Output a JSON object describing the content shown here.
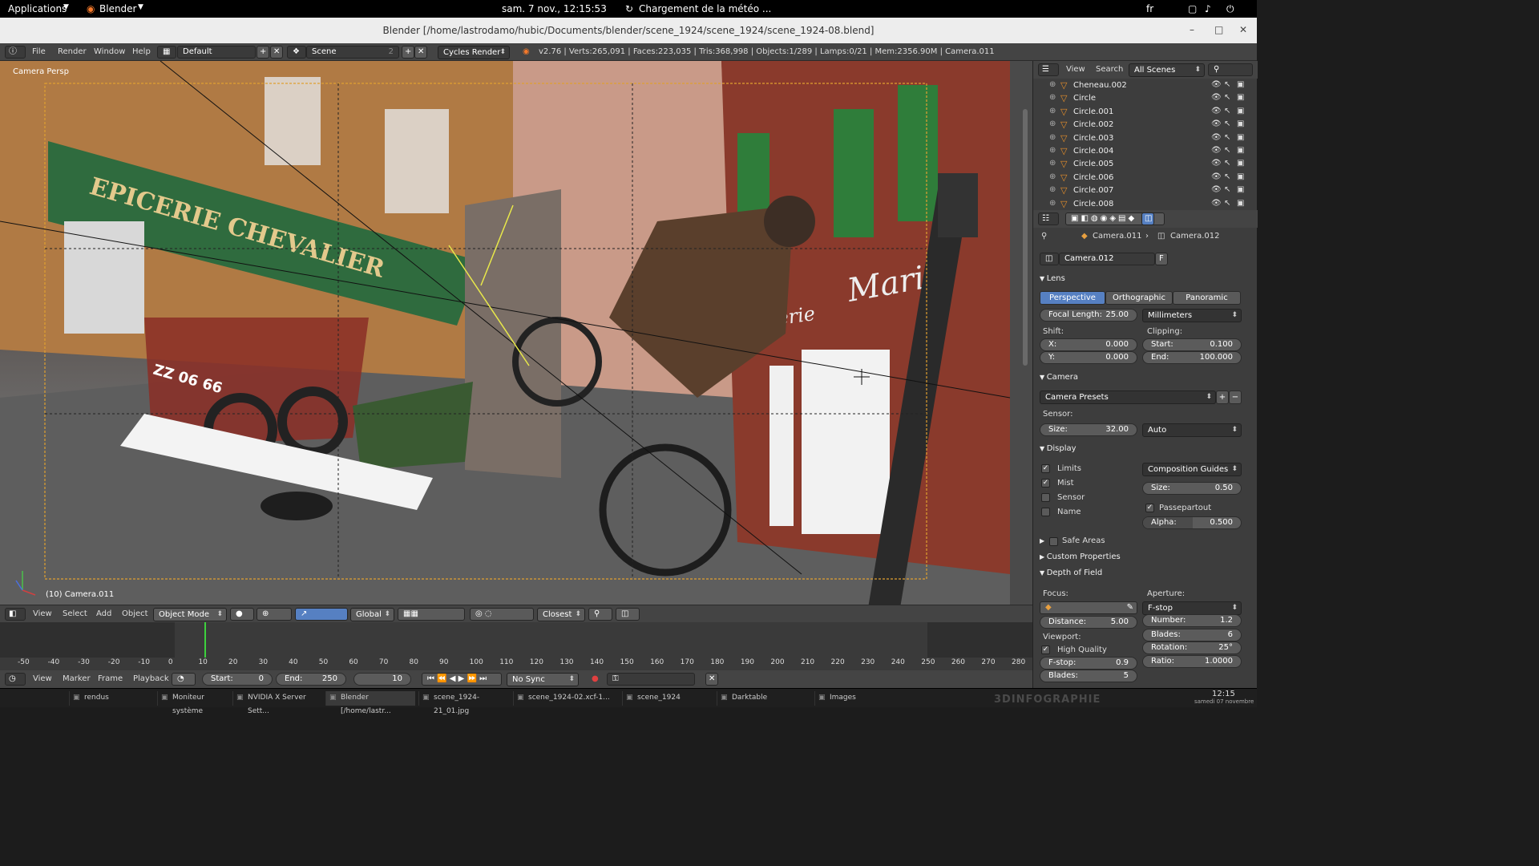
{
  "topbar": {
    "applications": "Applications",
    "app": "Blender",
    "datetime": "sam.  7 nov., 12:15:53",
    "weather": "Chargement de la météo ...",
    "lang": "fr"
  },
  "window": {
    "title": "Blender [/home/lastrodamo/hubic/Documents/blender/scene_1924/scene_1924/scene_1924-08.blend]",
    "minimize": "–",
    "maximize": "□",
    "close": "✕"
  },
  "info": {
    "menus": [
      "File",
      "Render",
      "Window",
      "Help"
    ],
    "layout": "Default",
    "scene": "Scene",
    "scene_users": "2",
    "engine": "Cycles Render",
    "stats": "v2.76 | Verts:265,091 | Faces:223,035 | Tris:368,998 | Objects:1/289 | Lamps:0/21 | Mem:2356.90M | Camera.011"
  },
  "viewport": {
    "label": "Camera Persp",
    "object_label": "(10) Camera.011",
    "sign1": "EPICERIE CHEVALIER",
    "plate": "ZZ 06 66",
    "sign2": "Mario",
    "sign3": "Boucherie"
  },
  "vpheader": {
    "menus": [
      "View",
      "Select",
      "Add",
      "Object"
    ],
    "mode": "Object Mode",
    "orientation": "Global",
    "snap": "Closest"
  },
  "timeline": {
    "ticks": [
      "-50",
      "-40",
      "-30",
      "-20",
      "-10",
      "0",
      "10",
      "20",
      "30",
      "40",
      "50",
      "60",
      "70",
      "80",
      "90",
      "100",
      "110",
      "120",
      "130",
      "140",
      "150",
      "160",
      "170",
      "180",
      "190",
      "200",
      "210",
      "220",
      "230",
      "240",
      "250",
      "260",
      "270",
      "280"
    ],
    "current_frame": 10,
    "frame_min": -50,
    "frame_max": 280,
    "scene_start": 0,
    "scene_end": 250
  },
  "tlheader": {
    "menus": [
      "View",
      "Marker",
      "Frame",
      "Playback"
    ],
    "start_label": "Start:",
    "start": "0",
    "end_label": "End:",
    "end": "250",
    "current": "10",
    "sync": "No Sync"
  },
  "outliner": {
    "view": "View",
    "search": "Search",
    "scenes": "All Scenes",
    "items": [
      "Cheneau.002",
      "Circle",
      "Circle.001",
      "Circle.002",
      "Circle.003",
      "Circle.004",
      "Circle.005",
      "Circle.006",
      "Circle.007",
      "Circle.008"
    ]
  },
  "props": {
    "breadcrumb1": "Camera.011",
    "breadcrumb2": "Camera.012",
    "datablock": "Camera.012",
    "fake": "F",
    "lens": {
      "title": "Lens",
      "perspective": "Perspective",
      "orthographic": "Orthographic",
      "panoramic": "Panoramic",
      "focal_label": "Focal Length:",
      "focal": "25.00",
      "unit": "Millimeters",
      "shift": "Shift:",
      "x_label": "X:",
      "x": "0.000",
      "y_label": "Y:",
      "y": "0.000",
      "clipping": "Clipping:",
      "start_label": "Start:",
      "start": "0.100",
      "end_label": "End:",
      "end": "100.000"
    },
    "camera": {
      "title": "Camera",
      "presets": "Camera Presets",
      "sensor": "Sensor:",
      "size_label": "Size:",
      "size": "32.00",
      "fit": "Auto"
    },
    "display": {
      "title": "Display",
      "limits": "Limits",
      "mist": "Mist",
      "sensor": "Sensor",
      "name": "Name",
      "guides": "Composition Guides",
      "size_label": "Size:",
      "size": "0.50",
      "passepartout": "Passepartout",
      "alpha_label": "Alpha:",
      "alpha": "0.500",
      "alpha_fraction": 0.5
    },
    "safe_areas": "Safe Areas",
    "custom": "Custom Properties",
    "dof": {
      "title": "Depth of Field",
      "focus": "Focus:",
      "aperture": "Aperture:",
      "fstop_mode": "F-stop",
      "distance_label": "Distance:",
      "distance": "5.00",
      "number_label": "Number:",
      "number": "1.2",
      "viewport": "Viewport:",
      "blades_label": "Blades:",
      "blades": "6",
      "high_quality": "High Quality",
      "rotation_label": "Rotation:",
      "rotation": "25°",
      "fstop_label": "F-stop:",
      "fstop": "0.9",
      "ratio_label": "Ratio:",
      "ratio": "1.0000",
      "vblades_label": "Blades:",
      "vblades": "5"
    }
  },
  "taskbar": {
    "items": [
      "rendus",
      "Moniteur système",
      "NVIDIA X Server Sett...",
      "Blender [/home/lastr...",
      "scene_1924-21_01.jpg",
      "scene_1924-02.xcf-1...",
      "scene_1924",
      "Darktable",
      "Images"
    ],
    "clock": "12:15",
    "date": "samedi 07 novembre",
    "watermark": "3DINFOGRAPHIE"
  },
  "colors": {
    "accent": "#5680c2",
    "camera_frame": "#e0a030",
    "shop_green": "#2f6b3e",
    "brick": "#8a3a2c",
    "active_frame": "#3dd13d"
  }
}
